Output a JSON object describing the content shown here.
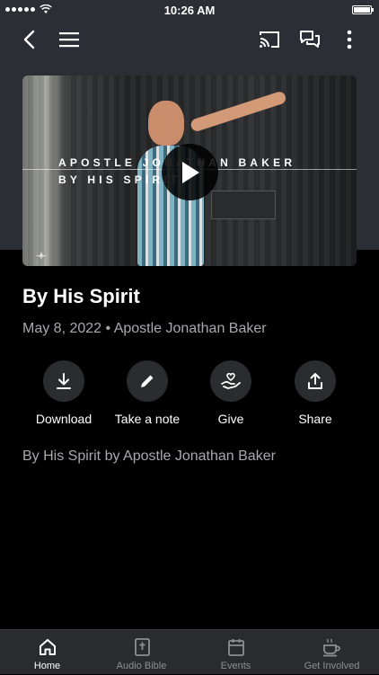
{
  "status_bar": {
    "time": "10:26 AM"
  },
  "video": {
    "overlay_title": "APOSTLE JONATHAN BAKER",
    "overlay_subtitle": "BY HIS SPIRIT"
  },
  "sermon": {
    "title": "By His Spirit",
    "date": "May 8, 2022",
    "speaker": "Apostle Jonathan Baker",
    "description": "By His Spirit by Apostle Jonathan Baker"
  },
  "actions": [
    {
      "label": "Download",
      "icon": "download-icon"
    },
    {
      "label": "Take a note",
      "icon": "pencil-icon"
    },
    {
      "label": "Give",
      "icon": "heart-hand-icon"
    },
    {
      "label": "Share",
      "icon": "share-icon"
    }
  ],
  "tabs": [
    {
      "label": "Home",
      "icon": "home-icon",
      "active": true
    },
    {
      "label": "Audio Bible",
      "icon": "bible-icon",
      "active": false
    },
    {
      "label": "Events",
      "icon": "calendar-icon",
      "active": false
    },
    {
      "label": "Get Involved",
      "icon": "coffee-cup-icon",
      "active": false
    }
  ],
  "colors": {
    "background": "#000000",
    "header_background": "#2b2e35",
    "secondary_text": "#a9a9ad",
    "action_circle": "#2b2c2f",
    "tabbar_background": "#2a2b2e",
    "tab_inactive": "#8e8e93"
  }
}
